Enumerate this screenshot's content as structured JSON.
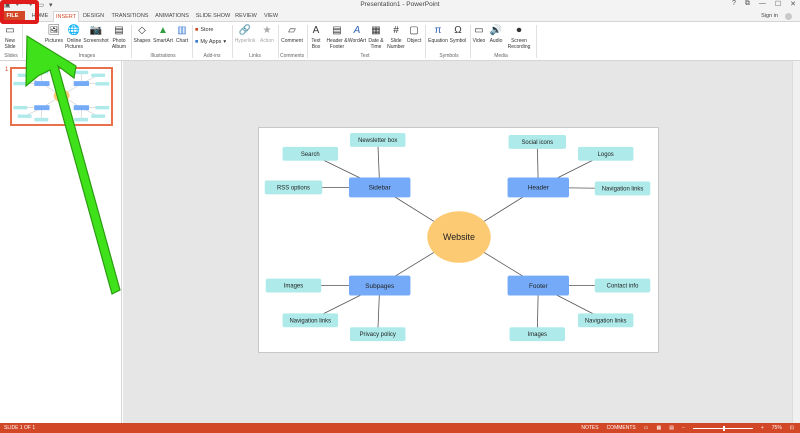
{
  "titlebar": {
    "title": "Presentation1 - PowerPoint",
    "qat_icons": [
      "save-icon",
      "undo-icon",
      "redo-icon",
      "start-slideshow-icon",
      "customize-icon"
    ],
    "window_controls": [
      "?",
      "⧉",
      "—",
      "☐",
      "✕"
    ]
  },
  "tabs": {
    "file": "FILE",
    "items": [
      "HOME",
      "INSERT",
      "DESIGN",
      "TRANSITIONS",
      "ANIMATIONS",
      "SLIDE SHOW",
      "REVIEW",
      "VIEW"
    ],
    "active": "INSERT",
    "sign_in": "Sign in"
  },
  "ribbon": {
    "new_slide": "New Slide",
    "pictures": "Pictures",
    "online_pictures": "Online Pictures",
    "screenshot": "Screenshot",
    "photo_album": "Photo Album",
    "shapes": "Shapes",
    "smartart": "SmartArt",
    "chart": "Chart",
    "store": "Store",
    "my_apps": "My Apps",
    "hyperlink": "Hyperlink",
    "action": "Action",
    "comment": "Comment",
    "text_box": "Text Box",
    "header_footer": "Header & Footer",
    "wordart": "WordArt",
    "date_time": "Date & Time",
    "slide_number": "Slide Number",
    "object": "Object",
    "equation": "Equation",
    "symbol": "Symbol",
    "video": "Video",
    "audio": "Audio",
    "screen_recording": "Screen Recording",
    "groups": {
      "slides": "Slides",
      "images": "Images",
      "illustrations": "Illustrations",
      "addins": "Add-ins",
      "links": "Links",
      "comments": "Comments",
      "text": "Text",
      "symbols": "Symbols",
      "media": "Media"
    }
  },
  "slide_panel": {
    "slide_number": "1"
  },
  "mindmap": {
    "center": "Website",
    "branches": [
      {
        "label": "Sidebar",
        "leaves": [
          "Newsletter box",
          "Search",
          "RSS options"
        ]
      },
      {
        "label": "Header",
        "leaves": [
          "Social icons",
          "Logos",
          "Navigation links"
        ]
      },
      {
        "label": "Subpages",
        "leaves": [
          "Images",
          "Navigation links",
          "Privacy policy"
        ]
      },
      {
        "label": "Footer",
        "leaves": [
          "Contact info",
          "Navigation links",
          "Images"
        ]
      }
    ],
    "colors": {
      "center": "#fdca74",
      "branch": "#74aaf7",
      "leaf": "#aeeaea",
      "line": "#555555"
    }
  },
  "statusbar": {
    "slide_info": "SLIDE 1 OF 1",
    "notes": "NOTES",
    "comments": "COMMENTS",
    "zoom": "75%",
    "accent": "#d24726"
  }
}
